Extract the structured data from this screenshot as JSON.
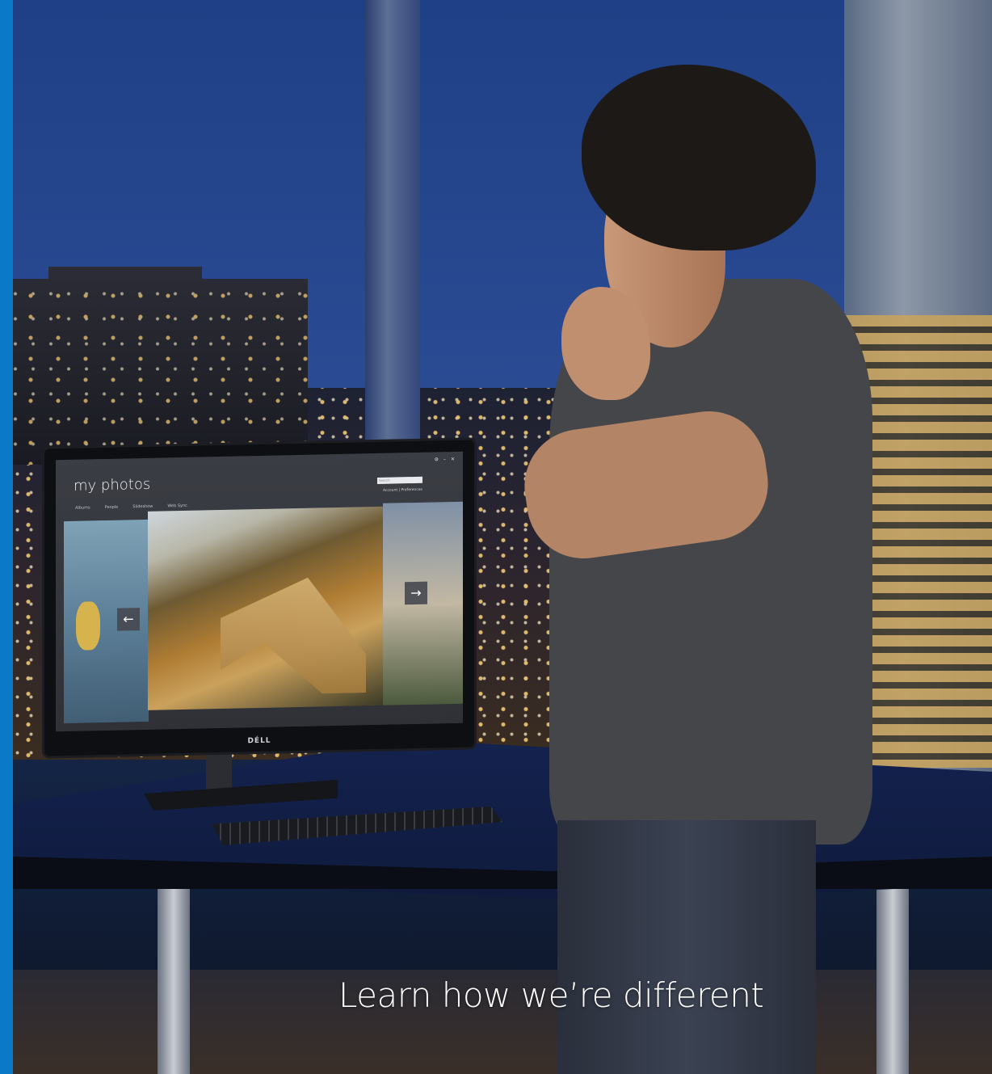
{
  "accent_color": "#0a7ac8",
  "cta": {
    "label": "Learn how we’re different"
  },
  "monitor": {
    "brand": "DÉLL",
    "app": {
      "title": "my photos",
      "nav": [
        "Albums",
        "People",
        "Slideshow",
        "Web Sync"
      ],
      "search_placeholder": "Search",
      "account_text": "Account  |  Preferences",
      "prev_icon": "arrow-left-icon",
      "next_icon": "arrow-right-icon"
    }
  }
}
